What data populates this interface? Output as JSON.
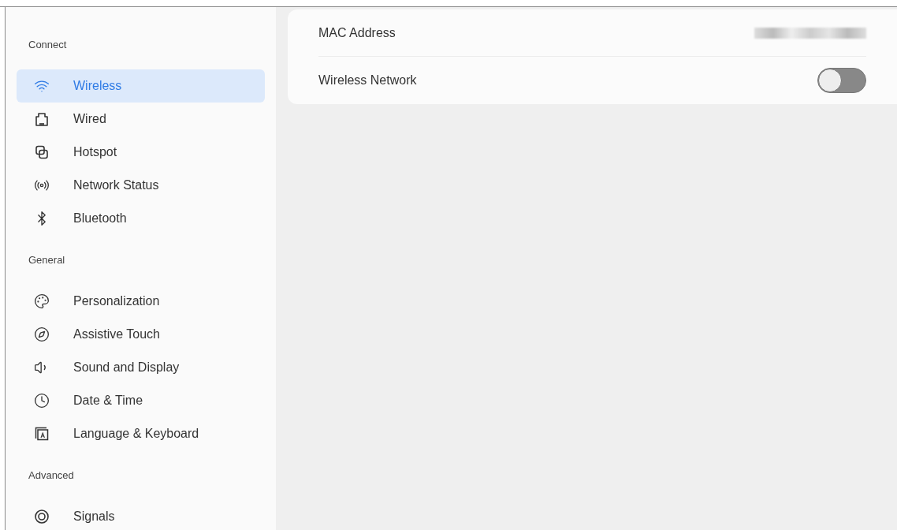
{
  "sidebar": {
    "sections": [
      {
        "title": "Connect",
        "items": [
          {
            "label": "Wireless",
            "kind": "wifi",
            "selected": true
          },
          {
            "label": "Wired",
            "kind": "ethernet",
            "selected": false
          },
          {
            "label": "Hotspot",
            "kind": "hotspot",
            "selected": false
          },
          {
            "label": "Network Status",
            "kind": "radio",
            "selected": false
          },
          {
            "label": "Bluetooth",
            "kind": "bluetooth",
            "selected": false
          }
        ]
      },
      {
        "title": "General",
        "items": [
          {
            "label": "Personalization",
            "kind": "palette",
            "selected": false
          },
          {
            "label": "Assistive Touch",
            "kind": "compass",
            "selected": false
          },
          {
            "label": "Sound and Display",
            "kind": "speaker",
            "selected": false
          },
          {
            "label": "Date & Time",
            "kind": "clock",
            "selected": false
          },
          {
            "label": "Language & Keyboard",
            "kind": "language",
            "selected": false
          }
        ]
      },
      {
        "title": "Advanced",
        "items": [
          {
            "label": "Signals",
            "kind": "signals",
            "selected": false
          }
        ]
      }
    ]
  },
  "settings": [
    {
      "kind": "info",
      "label": "MAC Address"
    },
    {
      "kind": "toggle",
      "label": "Wireless Network",
      "on": false
    }
  ]
}
